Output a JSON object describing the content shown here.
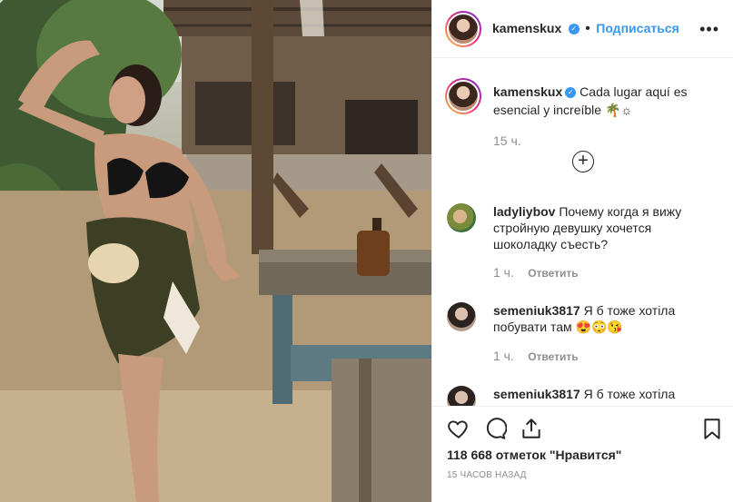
{
  "header": {
    "username": "kamenskux",
    "follow_label": "Подписаться",
    "more_icon": "more-icon"
  },
  "caption": {
    "username": "kamenskux",
    "text": "Cada lugar aquí es esencial y increíble 🌴☼",
    "time": "15 ч."
  },
  "load_more_icon": "plus-circle-icon",
  "comments": [
    {
      "username": "ladyliybov",
      "text": "Почему когда я вижу стройную девушку хочется шоколадку съесть?",
      "time": "1 ч.",
      "reply": "Ответить"
    },
    {
      "username": "semeniuk3817",
      "text": "Я б тоже хотіла побувати там 😍😳😘",
      "time": "1 ч.",
      "reply": "Ответить"
    },
    {
      "username": "semeniuk3817",
      "text": "Я б тоже хотіла"
    }
  ],
  "footer": {
    "likes": "118 668 отметок \"Нравится\"",
    "ago": "15 ЧАСОВ НАЗАД",
    "icons": [
      "heart-icon",
      "comment-icon",
      "share-icon",
      "bookmark-icon"
    ]
  },
  "colors": {
    "accent": "#3897f0",
    "text": "#262626",
    "muted": "#8e8e8e",
    "border": "#efefef"
  }
}
